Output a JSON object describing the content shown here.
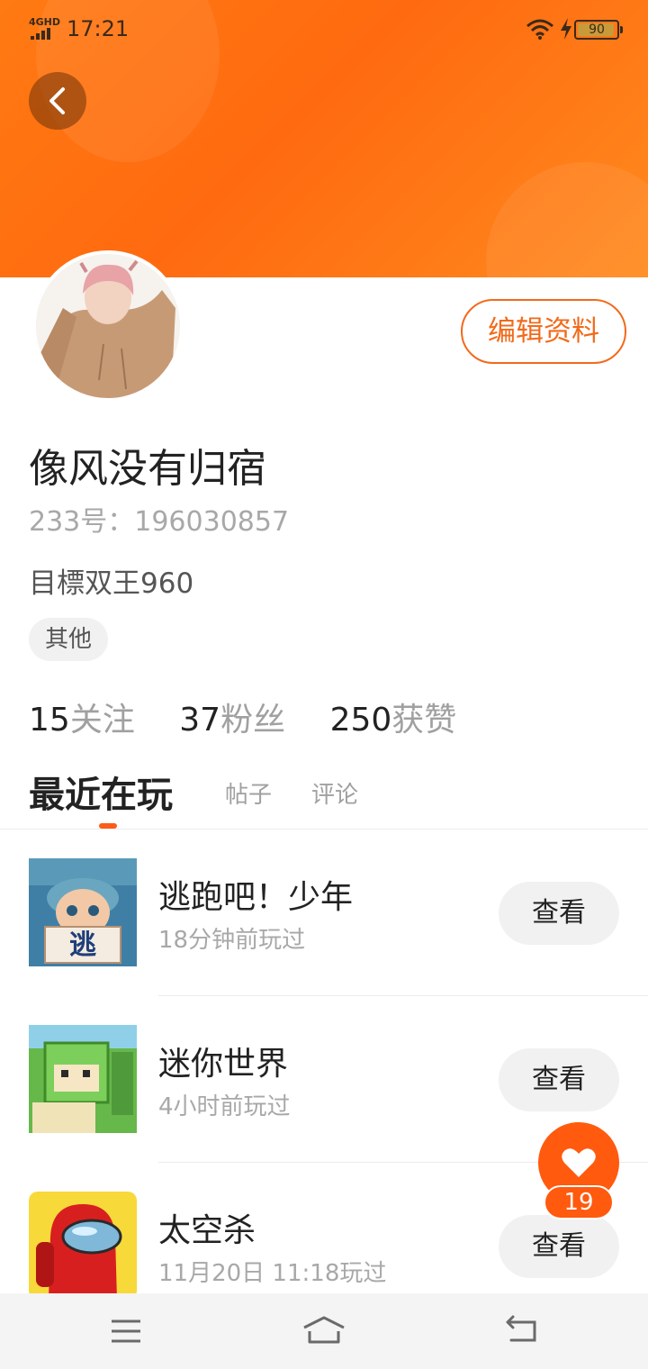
{
  "status_bar": {
    "network": "4GHD",
    "time": "17:21",
    "battery": "90"
  },
  "header": {
    "back_icon": "chevron-left-icon"
  },
  "profile": {
    "username": "像风没有归宿",
    "id_text": "233号：196030857",
    "bio": "目標双王960",
    "tag": "其他",
    "edit_label": "编辑资料"
  },
  "stats": [
    {
      "value": "15",
      "label": "关注"
    },
    {
      "value": "37",
      "label": "粉丝"
    },
    {
      "value": "250",
      "label": "获赞"
    }
  ],
  "tabs": [
    {
      "label": "最近在玩",
      "active": true
    },
    {
      "label": "帖子",
      "active": false
    },
    {
      "label": "评论",
      "active": false
    }
  ],
  "games": [
    {
      "name": "逃跑吧！少年",
      "time": "18分钟前玩过",
      "button": "查看",
      "thumb_text": "逃"
    },
    {
      "name": "迷你世界",
      "time": "4小时前玩过",
      "button": "查看"
    },
    {
      "name": "太空杀",
      "time": "11月20日 11:18玩过",
      "button": "查看"
    }
  ],
  "fab": {
    "icon": "heart-icon",
    "count": "19"
  },
  "nav": {
    "menu_icon": "menu-icon",
    "home_icon": "home-icon",
    "back_icon": "back-icon"
  },
  "colors": {
    "accent": "#ff5a0e",
    "header": "#ff7a12",
    "edit_border": "#f26a1b"
  }
}
